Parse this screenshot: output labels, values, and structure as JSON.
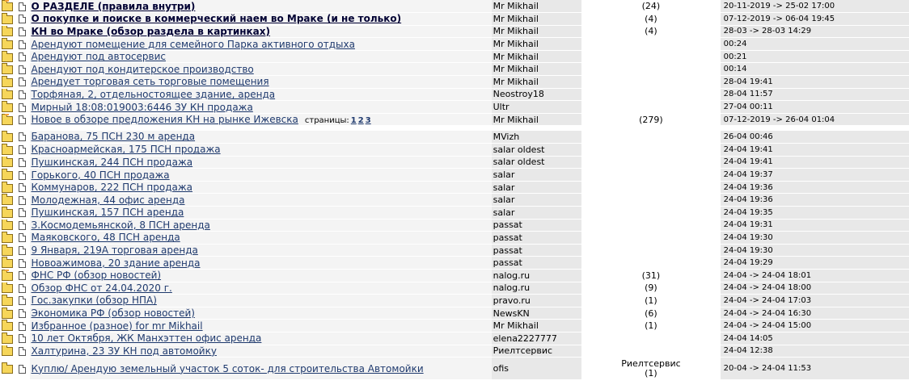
{
  "pages_label": "страницы:",
  "rows": [
    {
      "hot": true,
      "title": "О РАЗДЕЛЕ (правила внутри)",
      "bold": true,
      "author": "Mr Mikhail",
      "count": "(24)",
      "date": "20-11-2019 -> 25-02 17:00"
    },
    {
      "hot": false,
      "title": "О покупке и поиске в коммерческий наем во Мраке (и не только)",
      "bold": true,
      "author": "Mr Mikhail",
      "count": "(4)",
      "date": "07-12-2019 -> 06-04 19:45"
    },
    {
      "hot": false,
      "title": "КН во Мраке (обзор раздела в картинках)",
      "bold": true,
      "author": "Mr Mikhail",
      "count": "(4)",
      "date": "28-03 -> 28-03 14:29"
    },
    {
      "hot": false,
      "title": "Арендуют помещение для семейного Парка активного отдыха",
      "author": "Mr Mikhail",
      "count": "",
      "date": "00:24"
    },
    {
      "hot": false,
      "title": "Арендуют под автосервис",
      "author": "Mr Mikhail",
      "count": "",
      "date": "00:21"
    },
    {
      "hot": false,
      "title": "Арендуют под кондитерское производство",
      "author": "Mr Mikhail",
      "count": "",
      "date": "00:14"
    },
    {
      "hot": false,
      "title": "Арендует торговая сеть торговые помещения",
      "author": "Mr Mikhail",
      "count": "",
      "date": "28-04 19:41"
    },
    {
      "hot": false,
      "title": "Торфяная, 2, отдельностоящее здание, аренда",
      "author": "Neostroy18",
      "count": "",
      "date": "28-04 11:57"
    },
    {
      "hot": false,
      "title": "Мирный 18:08:019003:6446 ЗУ КН продажа",
      "author": "Ultr",
      "count": "",
      "date": "27-04 00:11"
    },
    {
      "hot": true,
      "title": "Новое в обзоре предложения КН на рынке Ижевска",
      "author": "Mr Mikhail",
      "count": "(279)",
      "date": "07-12-2019 -> 26-04 01:04",
      "pages": [
        "1",
        "2",
        "3"
      ]
    }
  ],
  "rows2": [
    {
      "hot": false,
      "title": "Баранова, 75 ПСН 230 м аренда",
      "author": "MVizh",
      "count": "",
      "date": "26-04 00:46"
    },
    {
      "hot": false,
      "title": "Красноармейская, 175 ПСН продажа",
      "author": "salar oldest",
      "count": "",
      "date": "24-04 19:41"
    },
    {
      "hot": false,
      "title": "Пушкинская, 244 ПСН продажа",
      "author": "salar oldest",
      "count": "",
      "date": "24-04 19:41"
    },
    {
      "hot": false,
      "title": "Горького, 40 ПСН продажа",
      "author": "salar",
      "count": "",
      "date": "24-04 19:37"
    },
    {
      "hot": false,
      "title": "Коммунаров, 222 ПСН продажа",
      "author": "salar",
      "count": "",
      "date": "24-04 19:36"
    },
    {
      "hot": false,
      "title": "Молодежная, 44 офис аренда",
      "author": "salar",
      "count": "",
      "date": "24-04 19:36"
    },
    {
      "hot": false,
      "title": "Пушкинская, 157 ПСН аренда",
      "author": "salar",
      "count": "",
      "date": "24-04 19:35"
    },
    {
      "hot": false,
      "title": "З.Космодемьянской, 8 ПСН аренда",
      "author": "passat",
      "count": "",
      "date": "24-04 19:31"
    },
    {
      "hot": false,
      "title": "Маяковского, 48 ПСН аренда",
      "author": "passat",
      "count": "",
      "date": "24-04 19:30"
    },
    {
      "hot": false,
      "title": "9 Января, 219А торговая аренда",
      "author": "passat",
      "count": "",
      "date": "24-04 19:30"
    },
    {
      "hot": false,
      "title": "Новоажимова, 20 здание аренда",
      "author": "passat",
      "count": "",
      "date": "24-04 19:29"
    },
    {
      "hot": true,
      "title": "ФНС РФ (обзор новостей)",
      "author": "nalog.ru",
      "count": "(31)",
      "date": "24-04 -> 24-04 18:01"
    },
    {
      "hot": false,
      "title": "Обзор ФНС от 24.04.2020 г.",
      "author": "nalog.ru",
      "count": "(9)",
      "date": "24-04 -> 24-04 18:00"
    },
    {
      "hot": false,
      "title": "Гос.закупки (обзор НПА)",
      "author": "pravo.ru",
      "count": "(1)",
      "date": "24-04 -> 24-04 17:03"
    },
    {
      "hot": false,
      "title": "Экономика РФ (обзор новостей)",
      "author": "NewsKN",
      "count": "(6)",
      "date": "24-04 -> 24-04 16:30"
    },
    {
      "hot": false,
      "title": "Избранное (разное) for mr Mikhail",
      "author": "Mr Mikhail",
      "count": "(1)",
      "date": "24-04 -> 24-04 15:00"
    },
    {
      "hot": false,
      "title": "10 лет Октября, ЖК Манхэттен офис аренда",
      "author": "elena2227777",
      "count": "",
      "date": "24-04 14:05"
    },
    {
      "hot": false,
      "title": "Халтурина, 23 ЗУ КН под автомойку",
      "author": "Риелтсервис",
      "count": "",
      "date": "24-04 12:38"
    },
    {
      "hot": false,
      "title": "Куплю/ Арендую земельный участок 5 соток- для строительства Автомойки",
      "author": "ofis",
      "count": "(1)",
      "count_author": "Риелтсервис",
      "date": "20-04 -> 24-04 11:53",
      "tall": true
    }
  ]
}
